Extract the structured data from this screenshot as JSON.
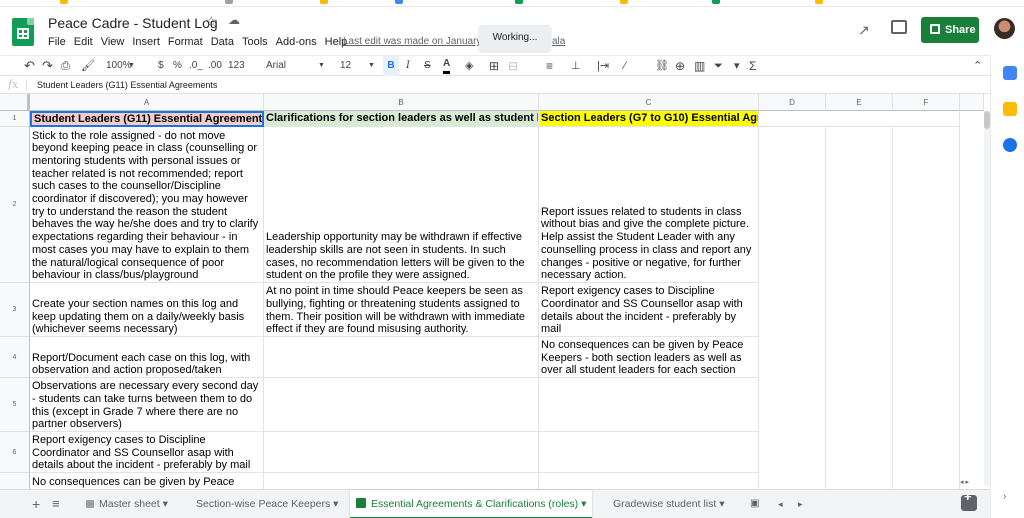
{
  "doc": {
    "title": "Peace Cadre - Student Log",
    "last_edit": "Last edit was made on January 1",
    "last_edit_tail": "ala",
    "working": "Working..."
  },
  "menu": [
    "File",
    "Edit",
    "View",
    "Insert",
    "Format",
    "Data",
    "Tools",
    "Add-ons",
    "Help"
  ],
  "share_label": "Share",
  "toolbar": {
    "zoom": "100%",
    "currency": "$",
    "percent": "%",
    "dec_less": ".0_",
    "dec_more": ".00",
    "format": "123",
    "font": "Arial",
    "size": "12",
    "bold": "B",
    "italic": "I",
    "strike": "S",
    "color": "A"
  },
  "formula_bar": {
    "fx": "fx",
    "value": "Student Leaders (G11) Essential Agreements"
  },
  "columns": [
    "A",
    "B",
    "C",
    "D",
    "E",
    "F"
  ],
  "rows": [
    "1",
    "2",
    "3",
    "4",
    "5",
    "6"
  ],
  "cells": {
    "a1": "Student Leaders (G11) Essential Agreements",
    "b1": "Clarifications for section leaders as well as student le",
    "c1": "Section Leaders (G7 to G10) Essential Agreements",
    "a2": "Stick to the role assigned - do not move beyond keeping peace in class (counselling or mentoring students with personal issues or teacher related is not recommended; report such cases to the counsellor/Discipline coordinator if discovered); you may however try to understand the reason the student behaves the way he/she does and try to clarify expectations regarding their behaviour - in most cases you may have to explain to them the natural/logical consequence of poor behaviour in class/bus/playground",
    "b2": "Leadership opportunity may be withdrawn if effective leadership skills are not seen in students. In such cases, no recommendation letters will be given to the student on the profile they were assigned.",
    "c2": "Report issues related to students in class without bias and give the complete picture. Help assist the Student Leader with any counselling process in class and report any changes - positive or negative, for further necessary action.",
    "a3": "Create your section names on this log and keep updating them on a daily/weekly basis (whichever seems necessary)",
    "b3": "At no point in time should Peace keepers be seen as bullying, fighting or threatening students assigned to them. Their position will be withdrawn with immediate effect if they are found misusing authority.",
    "c3": "Report exigency cases to Discipline Coordinator and SS Counsellor asap with details about the incident - preferably by mail",
    "a4": "Report/Document each case on this log, with observation and action proposed/taken",
    "c4": "No consequences can be given by Peace Keepers - both section leaders as well as over all student leaders for each section",
    "a5": "Observations are necessary every second day - students can take turns between them to do this (except in Grade 7 where there are no partner observers)",
    "a6": "Report exigency cases to Discipline Coordinator and SS Counsellor asap with details about the incident - preferably by mail",
    "a7": "No consequences can be given by Peace"
  },
  "tabs": {
    "master": "Master sheet",
    "section": "Section-wise Peace Keepers",
    "essential": "Essential Agreements & Clarifications (roles)",
    "gradewise": "Gradewise student list"
  },
  "colors": {
    "green": "#188038",
    "pink": "#f4cccc",
    "light_green": "#d9ead3",
    "yellow": "#ffff00"
  }
}
